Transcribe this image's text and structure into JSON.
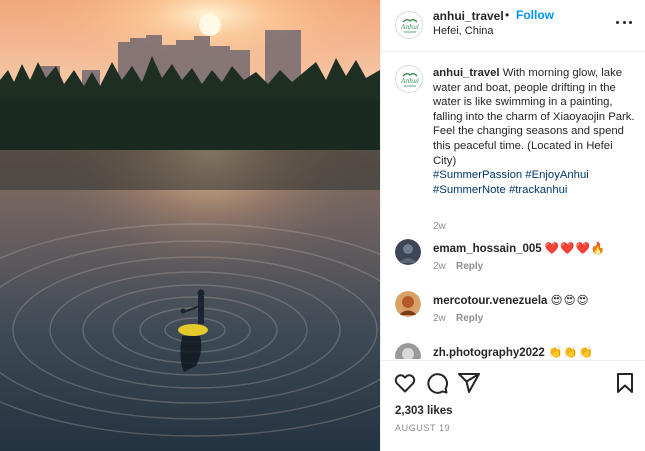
{
  "post": {
    "username": "anhui_travel",
    "dot": "•",
    "follow_label": "Follow",
    "location": "Hefei, China",
    "logo_text": "Anhui"
  },
  "caption": {
    "username": "anhui_travel",
    "text": "With morning glow, lake water and boat, people drifting in the water is like swimming in a painting, falling into the charm of Xiaoyaojin Park. Feel the changing seasons and spend this peaceful time. (Located in Hefei City)",
    "hashtags": [
      "#SummerPassion",
      "#EnjoyAnhui",
      "#SummerNote",
      "#trackanhui"
    ],
    "time": "2w"
  },
  "comments": [
    {
      "username": "emam_hossain_005",
      "text": "❤️❤️❤️🔥",
      "time": "2w",
      "reply_label": "Reply"
    },
    {
      "username": "mercotour.venezuela",
      "text": "😍😍😍",
      "time": "2w",
      "reply_label": "Reply"
    },
    {
      "username": "zh.photography2022",
      "text": "👏👏👏",
      "time": "",
      "reply_label": ""
    }
  ],
  "actions": {
    "icons": [
      "heart-icon",
      "comment-icon",
      "share-icon",
      "bookmark-icon"
    ]
  },
  "likes": "2,303 likes",
  "date": "AUGUST 19",
  "colors": {
    "accent": "#0095f6",
    "hashtag": "#00376b",
    "muted": "#8e8e8e",
    "heart": "#ed4956"
  }
}
